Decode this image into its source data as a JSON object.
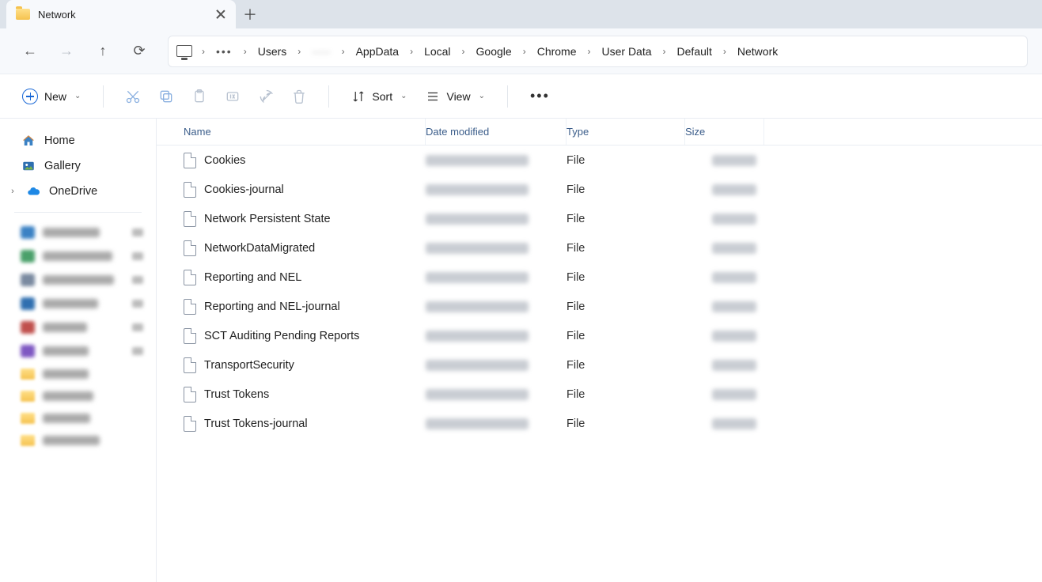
{
  "tab": {
    "title": "Network"
  },
  "breadcrumb": {
    "items": [
      "Users",
      "·····",
      "AppData",
      "Local",
      "Google",
      "Chrome",
      "User Data",
      "Default",
      "Network"
    ]
  },
  "toolbar": {
    "new_label": "New",
    "sort_label": "Sort",
    "view_label": "View"
  },
  "columns": {
    "name": "Name",
    "date": "Date modified",
    "type": "Type",
    "size": "Size"
  },
  "sidebar": {
    "home": "Home",
    "gallery": "Gallery",
    "onedrive": "OneDrive"
  },
  "files": [
    {
      "name": "Cookies",
      "type": "File"
    },
    {
      "name": "Cookies-journal",
      "type": "File"
    },
    {
      "name": "Network Persistent State",
      "type": "File"
    },
    {
      "name": "NetworkDataMigrated",
      "type": "File"
    },
    {
      "name": "Reporting and NEL",
      "type": "File"
    },
    {
      "name": "Reporting and NEL-journal",
      "type": "File"
    },
    {
      "name": "SCT Auditing Pending Reports",
      "type": "File"
    },
    {
      "name": "TransportSecurity",
      "type": "File"
    },
    {
      "name": "Trust Tokens",
      "type": "File"
    },
    {
      "name": "Trust Tokens-journal",
      "type": "File"
    }
  ]
}
